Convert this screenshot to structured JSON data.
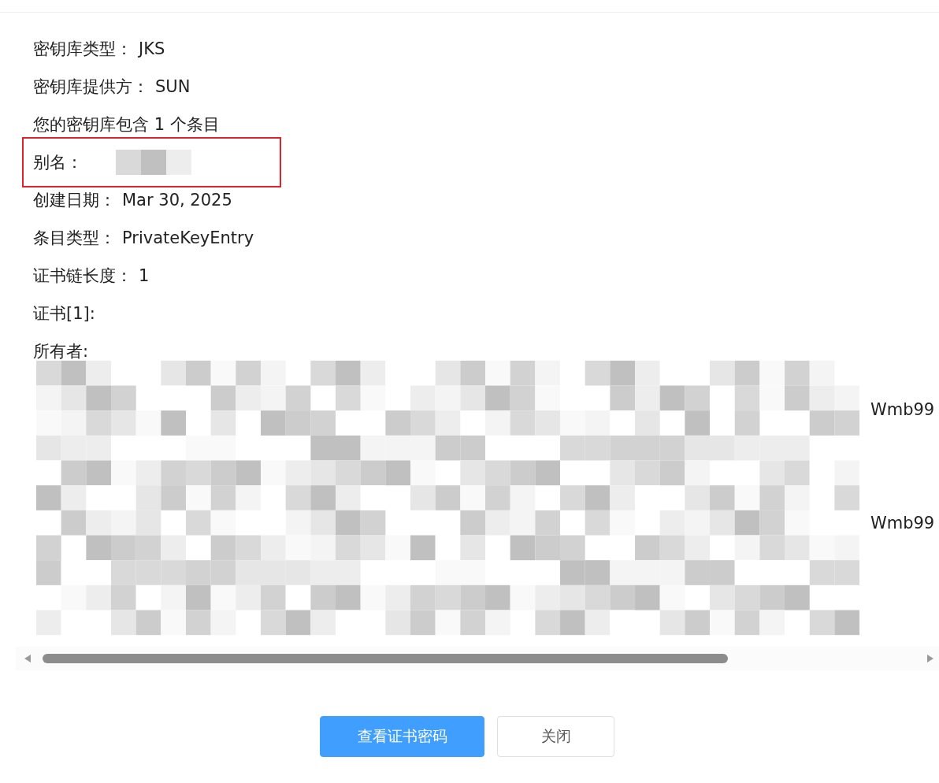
{
  "lines": [
    {
      "label": "密钥库类型：",
      "value": "JKS"
    },
    {
      "label": "密钥库提供方：",
      "value": "SUN"
    },
    {
      "label": "您的密钥库包含 1 个条目"
    },
    {
      "label": "别名：",
      "redacted": true,
      "highlighted": true
    },
    {
      "label": "创建日期：",
      "value": "Mar 30, 2025"
    },
    {
      "label": "条目类型：",
      "value": "PrivateKeyEntry"
    },
    {
      "label": "证书链长度：",
      "value": "1"
    },
    {
      "label": "证书[1]:"
    },
    {
      "label": "所有者:"
    }
  ],
  "redacted_tails": [
    "Wmb99",
    "Wmb99"
  ],
  "buttons": [
    {
      "label": "查看证书密码",
      "kind": "primary"
    },
    {
      "label": "关闭",
      "kind": "default"
    }
  ]
}
